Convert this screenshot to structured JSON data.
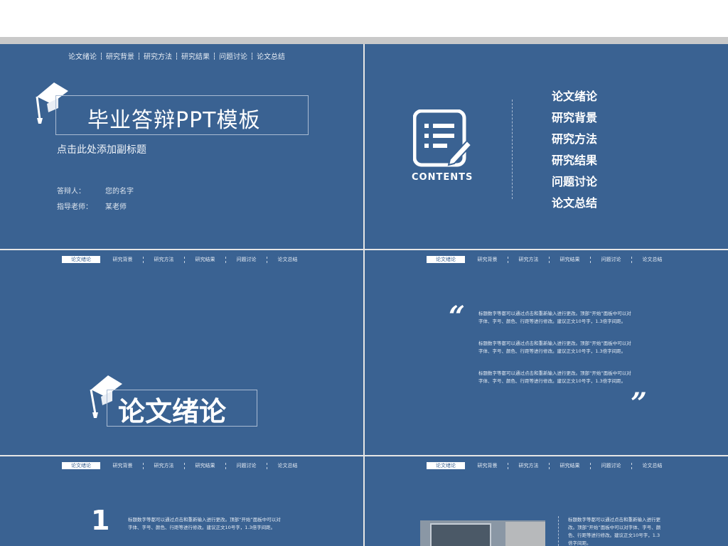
{
  "nav": [
    "论文绪论",
    "研究背景",
    "研究方法",
    "研究结果",
    "问题讨论",
    "论文总结"
  ],
  "slide1": {
    "title": "毕业答辩PPT模板",
    "subtitle": "点击此处添加副标题",
    "defender_label": "答辩人：",
    "defender_value": "您的名字",
    "advisor_label": "指导老师：",
    "advisor_value": "某老师",
    "icon": "graduation-cap-icon"
  },
  "slide2": {
    "contents_label": "CONTENTS",
    "icon": "document-edit-icon",
    "items": [
      "论文绪论",
      "研究背景",
      "研究方法",
      "研究结果",
      "问题讨论",
      "论文总结"
    ]
  },
  "slide3": {
    "title": "论文绪论",
    "icon": "graduation-cap-icon"
  },
  "slide4": {
    "open_quote": "“",
    "close_quote": "”",
    "paragraphs": [
      "标题数字等都可以通过点击和重新输入进行更改。顶部“开始”面板中可以对字体、字号、颜色、行距等进行修改。建议正文10号字，1.3倍字间距。",
      "标题数字等都可以通过点击和重新输入进行更改。顶部“开始”面板中可以对字体、字号、颜色、行距等进行修改。建议正文10号字，1.3倍字间距。",
      "标题数字等都可以通过点击和重新输入进行更改。顶部“开始”面板中可以对字体、字号、颜色、行距等进行修改。建议正文10号字，1.3倍字间距。"
    ]
  },
  "slide5": {
    "number": "1",
    "paragraph": "标题数字等都可以通过点击和重新输入进行更改。顶部“开始”面板中可以对字体、字号、颜色、行距等进行修改。建议正文10号字，1.3倍字间距。"
  },
  "slide6": {
    "paragraph": "标题数字等都可以通过点击和重新输入进行更改。顶部“开始”面板中可以对字体、字号、颜色、行距等进行修改。建议正文10号字，1.3倍字间距。"
  },
  "colors": {
    "slide_bg": "#3a6292",
    "border": "#a9bbd3",
    "text": "#ffffff"
  }
}
